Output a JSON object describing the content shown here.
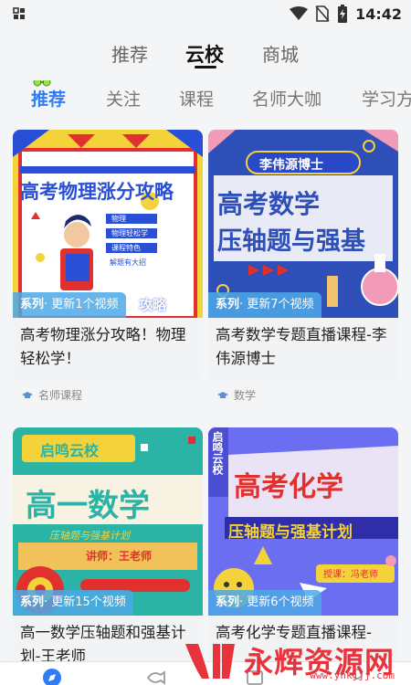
{
  "status_bar": {
    "time": "14:42",
    "icons": [
      "app-grid-icon",
      "wifi-icon",
      "no-sim-icon",
      "battery-charging-icon"
    ]
  },
  "top_tabs": [
    {
      "label": "推荐",
      "active": false
    },
    {
      "label": "云校",
      "active": true
    },
    {
      "label": "商城",
      "active": false
    }
  ],
  "sub_tabs": [
    {
      "label": "推荐",
      "active": true
    },
    {
      "label": "关注",
      "active": false
    },
    {
      "label": "课程",
      "active": false
    },
    {
      "label": "名师大咖",
      "active": false
    },
    {
      "label": "学习方",
      "active": false
    }
  ],
  "cards": [
    {
      "thumb_title": "高考物理涨分攻略",
      "thumb_bullets": [
        "物理",
        "物理轻松学",
        "课程特色",
        "解题有大招"
      ],
      "series_label": "系列",
      "series_update": "· 更新1个视频",
      "title": "高考物理涨分攻略！物理轻松学！",
      "meta": "名师课程",
      "tag_overlap_text": "攻略"
    },
    {
      "thumb_badge": "李伟源博士",
      "thumb_title_1": "高考数学",
      "thumb_title_2": "压轴题与强基",
      "series_label": "系列",
      "series_update": "· 更新7个视频",
      "title": "高考数学专题直播课程-李伟源博士",
      "meta": "数学"
    },
    {
      "thumb_badge": "启鸣云校",
      "thumb_title": "高一数学",
      "thumb_sub": "压轴题与强基计划",
      "thumb_teacher": "讲师：王老师",
      "series_label": "系列",
      "series_update": "· 更新15个视频",
      "title": "高一数学压轴题和强基计划-王老师",
      "meta": ""
    },
    {
      "thumb_badge": "启鸣云校",
      "thumb_title": "高考化学",
      "thumb_sub": "压轴题与强基计划",
      "thumb_teacher": "授课：冯老师",
      "series_label": "系列",
      "series_update": "· 更新6个视频",
      "title": "高考化学专题直播课程-",
      "meta": ""
    }
  ],
  "watermark": {
    "text": "永辉资源网",
    "url": "www.yhkjjj.com"
  },
  "colors": {
    "accent": "#2f7df6",
    "series_tag": "#4ca8e6",
    "watermark": "#e8323c"
  }
}
